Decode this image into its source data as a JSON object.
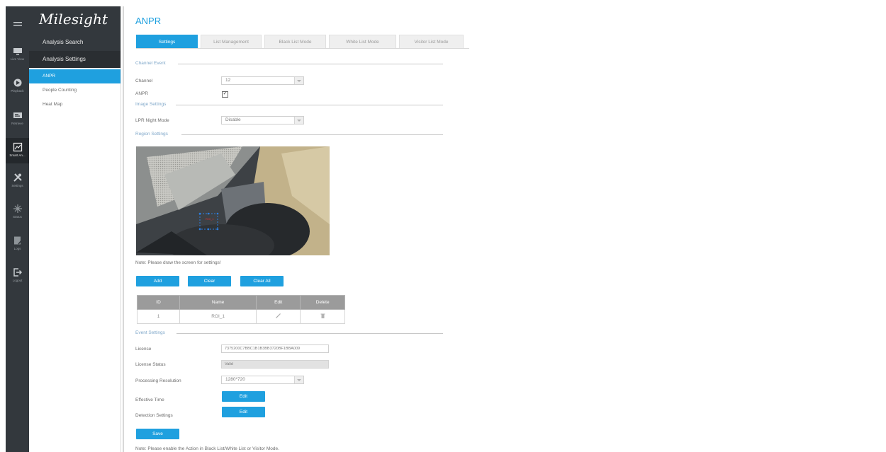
{
  "brand": {
    "logo": "Milesight"
  },
  "rail": [
    {
      "label": "Live View",
      "icon": "monitor-icon"
    },
    {
      "label": "Playback",
      "icon": "playback-icon"
    },
    {
      "label": "Retrieve",
      "icon": "retrieve-icon"
    },
    {
      "label": "Smart An...",
      "icon": "smart-analysis-icon"
    },
    {
      "label": "Settings",
      "icon": "settings-icon"
    },
    {
      "label": "Status",
      "icon": "status-icon"
    },
    {
      "label": "Logs",
      "icon": "logs-icon"
    },
    {
      "label": "Logout",
      "icon": "logout-icon"
    }
  ],
  "menu": {
    "analysis_search": "Analysis Search",
    "analysis_settings": "Analysis Settings",
    "items": [
      "ANPR",
      "People Counting",
      "Heat Map"
    ],
    "active": "ANPR"
  },
  "page": {
    "title": "ANPR",
    "tabs": [
      "Settings",
      "List Management",
      "Black List Mode",
      "White List Mode",
      "Visitor List Mode"
    ],
    "active_tab": "Settings"
  },
  "channel_event": {
    "section": "Channel Event",
    "channel_label": "Channel",
    "channel_value": "12",
    "anpr_label": "ANPR",
    "anpr_checked": true
  },
  "image_settings": {
    "section": "Image Settings",
    "night_mode_label": "LPR Night Mode",
    "night_mode_value": "Disable"
  },
  "region_settings": {
    "section": "Region Settings",
    "roi_overlay": "ROI_1",
    "note": "Note: Please draw the screen for settings!",
    "buttons": {
      "add": "Add",
      "clear": "Clear",
      "clear_all": "Clear All"
    },
    "table": {
      "columns": [
        "ID",
        "Name",
        "Edit",
        "Delete"
      ],
      "rows": [
        {
          "id": "1",
          "name": "ROI_1"
        }
      ]
    }
  },
  "event_settings": {
    "section": "Event Settings",
    "license_label": "License",
    "license_value": "7375200C7BBC1B1B3BB3720BF1BBA009",
    "license_status_label": "License Status",
    "license_status_value": "Valid",
    "resolution_label": "Processing Resolution",
    "resolution_value": "1280*720",
    "effective_time_label": "Effective Time",
    "detection_label": "Detection Settings",
    "edit_label": "Edit"
  },
  "save_label": "Save",
  "footer_note": "Note: Please enable the Action in Black List/White List or Visitor Mode.",
  "colors": {
    "accent": "#1fa0df",
    "rail": "#33383d",
    "section": "#7fa7c9"
  }
}
